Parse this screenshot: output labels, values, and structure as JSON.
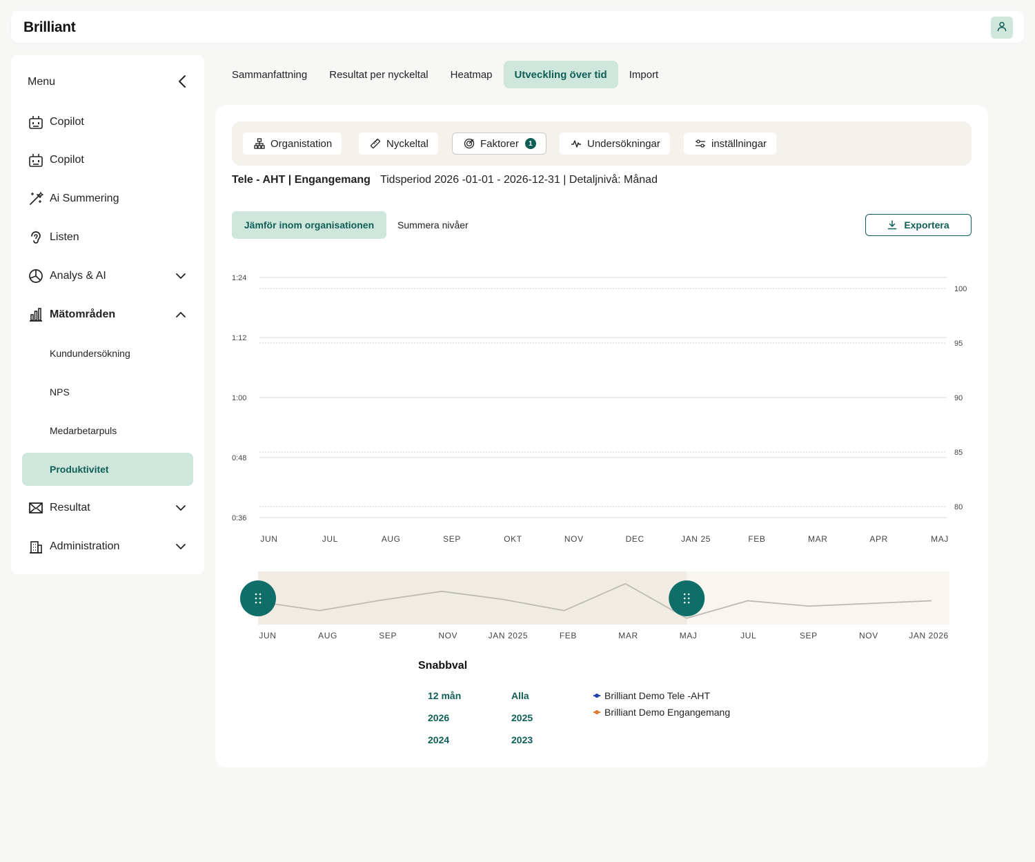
{
  "app": {
    "logo": "Brilliant",
    "user_icon": "user-icon"
  },
  "sidebar": {
    "title": "Menu",
    "items": [
      {
        "label": "Copilot",
        "icon": "robot-icon"
      },
      {
        "label": "Copilot",
        "icon": "robot-icon"
      },
      {
        "label": "Ai Summering",
        "icon": "magic-wand-icon"
      },
      {
        "label": "Listen",
        "icon": "ear-icon"
      },
      {
        "label": "Analys & AI",
        "icon": "pie-chart-icon",
        "expanded": false
      },
      {
        "label": "Mätområden",
        "icon": "bar-chart-icon",
        "expanded": true
      },
      {
        "label": "Resultat",
        "icon": "mail-icon",
        "expanded": false
      },
      {
        "label": "Administration",
        "icon": "building-icon",
        "expanded": false
      }
    ],
    "subitems": [
      "Kundundersökning",
      "NPS",
      "Medarbetarpuls",
      "Produktivitet"
    ],
    "active_subitem": "Produktivitet"
  },
  "tabs": [
    "Sammanfattning",
    "Resultat per nyckeltal",
    "Heatmap",
    "Utveckling över tid",
    "Import"
  ],
  "active_tab": "Utveckling över tid",
  "filters": [
    {
      "label": "Organistation",
      "icon": "org-tree-icon"
    },
    {
      "label": "Nyckeltal",
      "icon": "ruler-icon"
    },
    {
      "label": "Faktorer",
      "icon": "target-icon",
      "badge": "1"
    },
    {
      "label": "Undersökningar",
      "icon": "activity-icon"
    },
    {
      "label": "inställningar",
      "icon": "sliders-icon"
    }
  ],
  "info": {
    "title": "Tele - AHT | Engangemang",
    "period": "Tidsperiod 2026 -01-01 - 2026-12-31 | Detaljnivå: Månad"
  },
  "view_modes": {
    "active": "Jämför inom organisationen",
    "other": "Summera nivåer"
  },
  "export_label": "Exportera",
  "chart_data": {
    "type": "line",
    "left_axis": {
      "ticks": [
        "1:24",
        "1:12",
        "1:00",
        "0:48",
        "0:36"
      ]
    },
    "right_axis": {
      "ticks": [
        "100",
        "95",
        "90",
        "85",
        "80"
      ],
      "ylim": [
        80,
        100
      ]
    },
    "categories": [
      "JUN",
      "JUL",
      "AUG",
      "SEP",
      "OKT",
      "NOV",
      "DEC",
      "JAN 25",
      "FEB",
      "MAR",
      "APR",
      "MAJ"
    ],
    "series": [
      {
        "name": "Brilliant Demo Tele -AHT",
        "color": "#1f3fb0",
        "values": []
      },
      {
        "name": "Brilliant Demo Engangemang",
        "color": "#e07a2e",
        "values": []
      }
    ],
    "grid": true
  },
  "navigator": {
    "labels": [
      "JUN",
      "AUG",
      "SEP",
      "NOV",
      "JAN 2025",
      "FEB",
      "MAR",
      "MAJ",
      "JUL",
      "SEP",
      "NOV",
      "JAN 2026"
    ],
    "values": [
      0.45,
      0.25,
      0.48,
      0.68,
      0.5,
      0.25,
      0.85,
      0.08,
      0.47,
      0.35,
      0.41,
      0.47
    ],
    "selection": [
      0,
      0.62
    ]
  },
  "quick_select": {
    "title": "Snabbval",
    "options": [
      "12 mån",
      "Alla",
      "2026",
      "2025",
      "2024",
      "2023"
    ]
  }
}
